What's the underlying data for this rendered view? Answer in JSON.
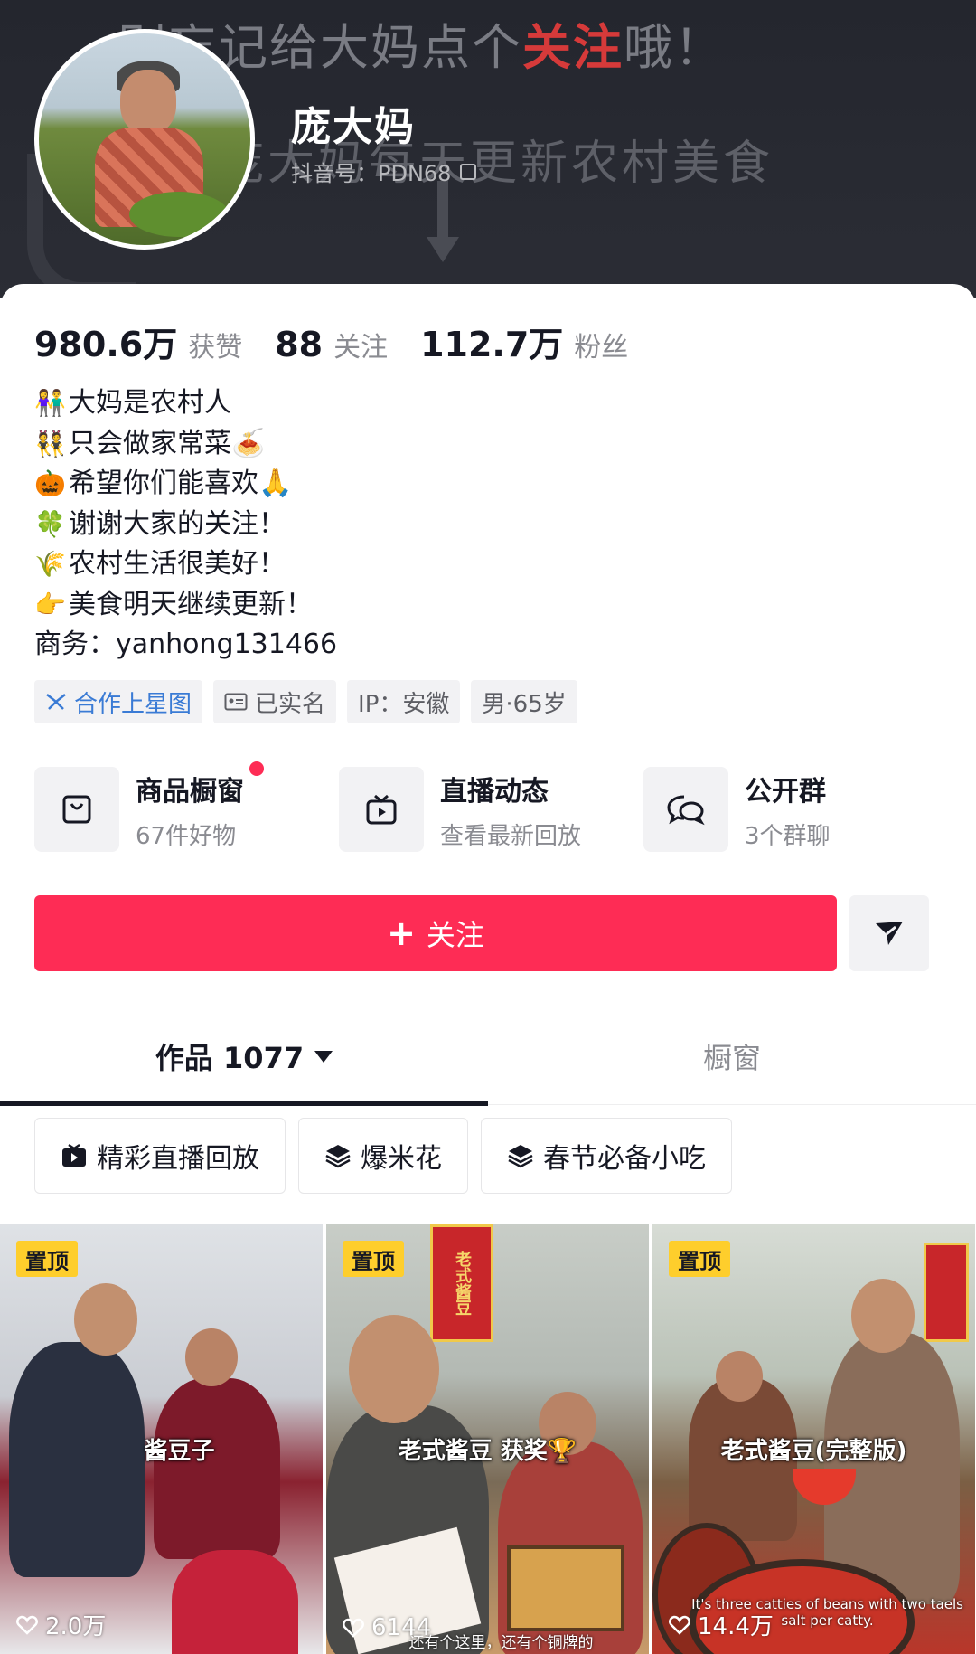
{
  "banner": {
    "deco_top_prefix": "别忘记给大妈点个",
    "deco_top_highlight": "关注",
    "deco_top_suffix": "哦！",
    "deco_mid": "庞大妈每天更新农村美食"
  },
  "profile": {
    "nickname": "庞大妈",
    "douyin_id": "抖音号：PDN68"
  },
  "stats": [
    {
      "value": "980.6万",
      "label": "获赞"
    },
    {
      "value": "88",
      "label": "关注"
    },
    {
      "value": "112.7万",
      "label": "粉丝"
    }
  ],
  "bio": [
    {
      "emoji": "👫",
      "text": "大妈是农村人"
    },
    {
      "emoji": "👯",
      "text": "只会做家常菜🍝"
    },
    {
      "emoji": "🎃",
      "text": "希望你们能喜欢🙏"
    },
    {
      "emoji": "🍀",
      "text": "谢谢大家的关注！"
    },
    {
      "emoji": "🌾",
      "text": "农村生活很美好！"
    },
    {
      "emoji": "👉",
      "text": "美食明天继续更新！"
    }
  ],
  "business": "商务：yanhong131466",
  "tags": [
    {
      "label": "合作上星图",
      "icon": "star-map-icon"
    },
    {
      "label": "已实名",
      "icon": "id-card-icon"
    },
    {
      "label": "IP：安徽"
    },
    {
      "label": "男·65岁"
    }
  ],
  "services": [
    {
      "title": "商品橱窗",
      "sub": "67件好物",
      "icon": "shopping-bag-icon"
    },
    {
      "title": "直播动态",
      "sub": "查看最新回放",
      "icon": "tv-play-icon"
    },
    {
      "title": "公开群",
      "sub": "3个群聊",
      "icon": "chat-bubbles-icon"
    }
  ],
  "follow_label": "关注",
  "tabs": {
    "works": "作品 1077",
    "window": "橱窗"
  },
  "collections": [
    {
      "label": "精彩直播回放",
      "icon": "live-replay-icon"
    },
    {
      "label": "爆米花",
      "icon": "layers-icon"
    },
    {
      "label": "春节必备小吃",
      "icon": "layers-icon"
    }
  ],
  "videos": [
    {
      "badge": "置顶",
      "caption": "酱豆子",
      "likes": "2.0万"
    },
    {
      "badge": "置顶",
      "caption": "老式酱豆 获奖🏆",
      "likes": "6144",
      "subtitle": "还有个这里，还有个铜牌的",
      "sign": "老式酱豆"
    },
    {
      "badge": "置顶",
      "caption": "老式酱豆(完整版)",
      "likes": "14.4万",
      "subtitle": "It's three catties of beans with two taels salt per catty."
    }
  ],
  "colors": {
    "accent": "#fe2c55",
    "pin_badge": "#fece2c",
    "banner_bg": "#24262e",
    "link_blue": "#3a7bd5"
  }
}
